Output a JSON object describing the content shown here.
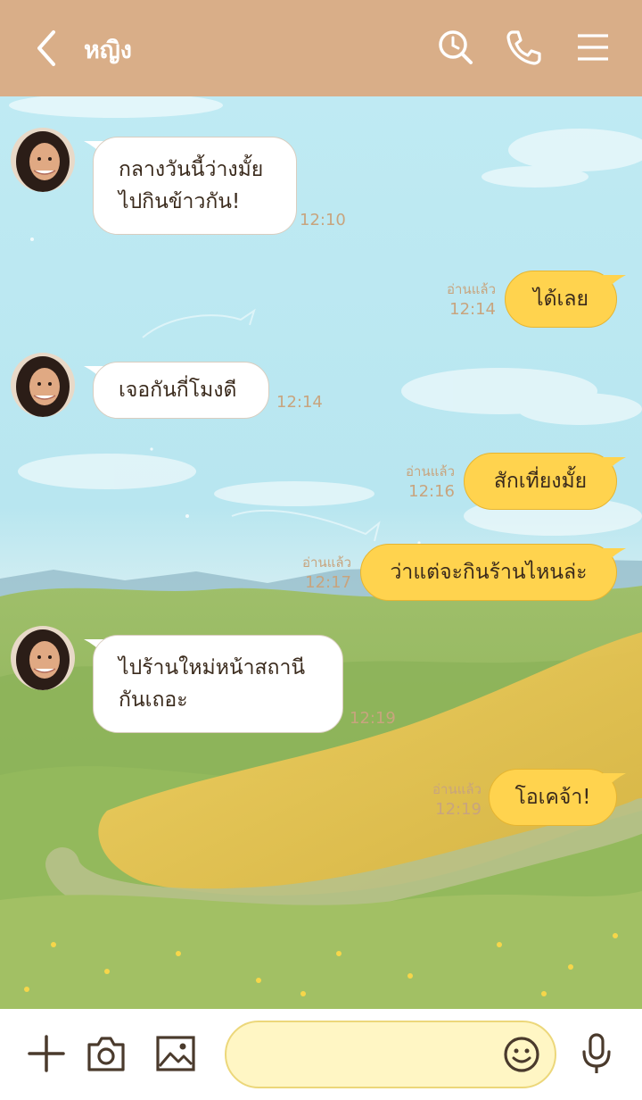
{
  "header": {
    "title": "หญิง",
    "icons": [
      "back-chevron-icon",
      "search-history-icon",
      "phone-icon",
      "menu-icon"
    ],
    "background": "#d9ae88"
  },
  "messages": [
    {
      "side": "in",
      "text": "กลางวันนี้ว่างมั้ย\nไปกินข้าวกัน!",
      "time": "12:10"
    },
    {
      "side": "out",
      "text": "ได้เลย",
      "read": "อ่านแล้ว",
      "time": "12:14"
    },
    {
      "side": "in",
      "text": "เจอกันกี่โมงดี",
      "time": "12:14"
    },
    {
      "side": "out",
      "text": "สักเที่ยงมั้ย",
      "read": "อ่านแล้ว",
      "time": "12:16"
    },
    {
      "side": "out",
      "text": "ว่าแต่จะกินร้านไหนล่ะ",
      "read": "อ่านแล้ว",
      "time": "12:17"
    },
    {
      "side": "in",
      "text": "ไปร้านใหม่หน้าสถานี\nกันเถอะ",
      "time": "12:19"
    },
    {
      "side": "out",
      "text": "โอเคจ้า!",
      "read": "อ่านแล้ว",
      "time": "12:19"
    }
  ],
  "footer": {
    "icons": [
      "plus-icon",
      "camera-icon",
      "image-icon",
      "smiley-icon",
      "microphone-icon"
    ],
    "input_placeholder": ""
  },
  "colors": {
    "incoming_bubble": "#ffffff",
    "outgoing_bubble": "#ffd34e",
    "timestamp": "#c8a47e"
  }
}
